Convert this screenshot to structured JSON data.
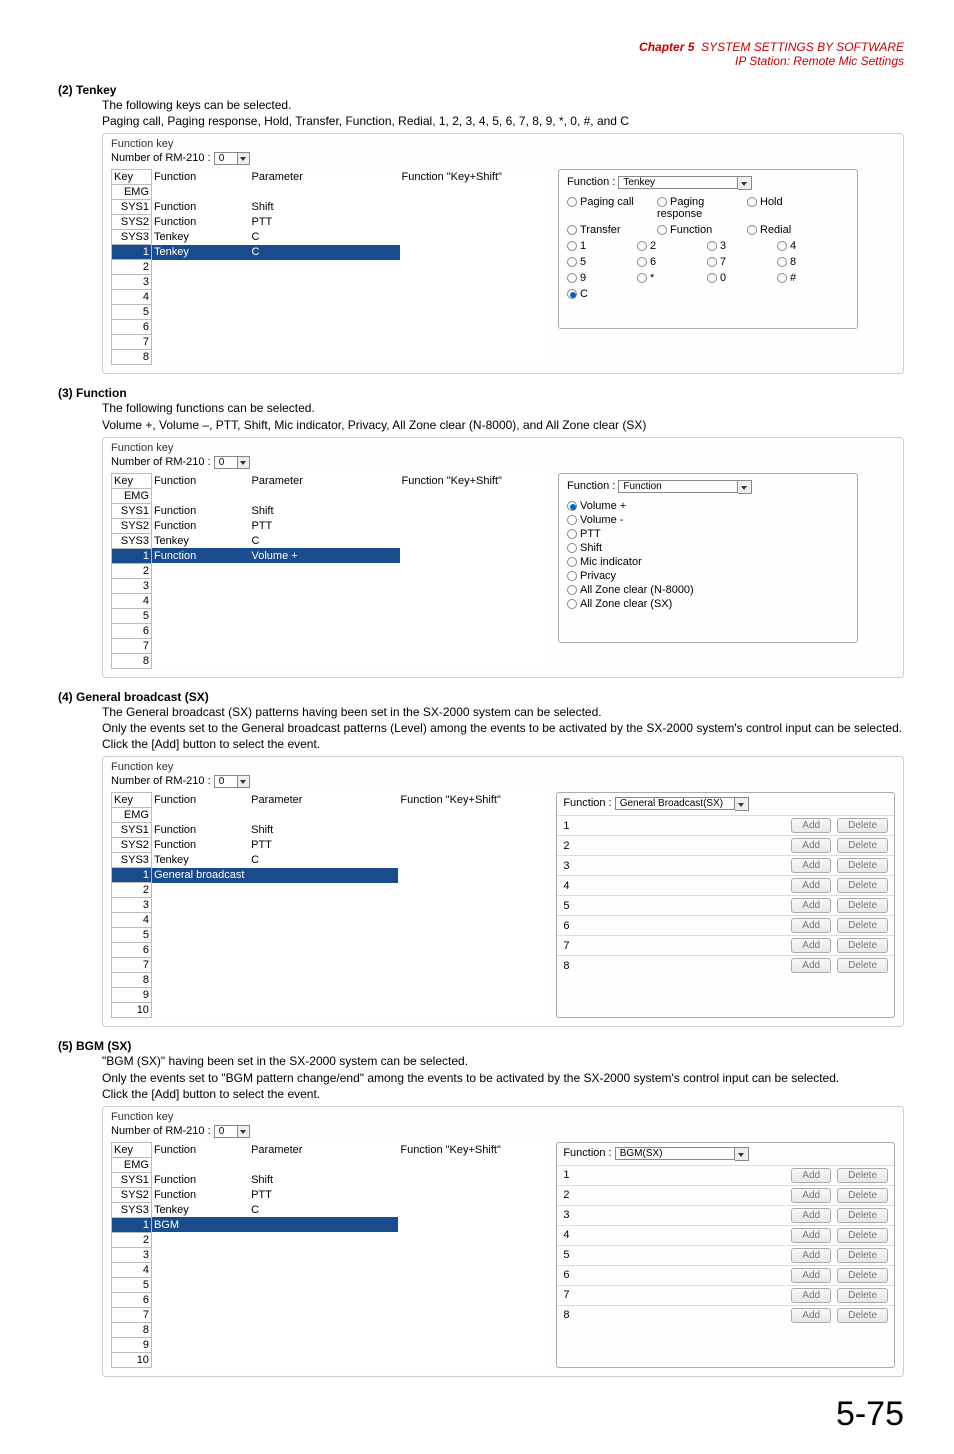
{
  "chapter": {
    "main": "Chapter 5",
    "title1": "SYSTEM SETTINGS BY SOFTWARE",
    "title2": "IP Station: Remote Mic Settings"
  },
  "sec2": {
    "label": "(2) Tenkey",
    "line1": "The following keys can be selected.",
    "line2": "Paging call, Paging response, Hold, Transfer, Function, Redial, 1, 2, 3, 4, 5, 6, 7, 8, 9, *, 0, #, and C",
    "panelTitle": "Function key",
    "rmLabel": "Number of RM-210 :",
    "rmVal": "0",
    "headers": {
      "key": "Key",
      "func": "Function",
      "param": "Parameter",
      "ks": "Function \"Key+Shift\""
    },
    "rows": [
      {
        "k": "EMG",
        "f": "",
        "p": ""
      },
      {
        "k": "SYS1",
        "f": "Function",
        "p": "Shift"
      },
      {
        "k": "SYS2",
        "f": "Function",
        "p": "PTT"
      },
      {
        "k": "SYS3",
        "f": "Tenkey",
        "p": "C"
      },
      {
        "k": "1",
        "f": "Tenkey",
        "p": "C",
        "hl": true
      },
      {
        "k": "2",
        "f": "",
        "p": ""
      },
      {
        "k": "3",
        "f": "",
        "p": ""
      },
      {
        "k": "4",
        "f": "",
        "p": ""
      },
      {
        "k": "5",
        "f": "",
        "p": ""
      },
      {
        "k": "6",
        "f": "",
        "p": ""
      },
      {
        "k": "7",
        "f": "",
        "p": ""
      },
      {
        "k": "8",
        "f": "",
        "p": ""
      }
    ],
    "right": {
      "label": "Function :",
      "value": "Tenkey",
      "radios": [
        {
          "l": "Paging call"
        },
        {
          "l": "Paging response"
        },
        {
          "l": "Hold"
        },
        {
          "l": "Transfer"
        },
        {
          "l": "Function"
        },
        {
          "l": "Redial"
        },
        {
          "l": "1",
          "half": true
        },
        {
          "l": "2",
          "half": true
        },
        {
          "l": "3",
          "half": true
        },
        {
          "l": "4",
          "half": true
        },
        {
          "l": "5",
          "half": true
        },
        {
          "l": "6",
          "half": true
        },
        {
          "l": "7",
          "half": true
        },
        {
          "l": "8",
          "half": true
        },
        {
          "l": "9",
          "half": true
        },
        {
          "l": "*",
          "half": true
        },
        {
          "l": "0",
          "half": true
        },
        {
          "l": "#",
          "half": true
        },
        {
          "l": "C",
          "half": true,
          "sel": true
        }
      ]
    }
  },
  "sec3": {
    "label": "(3) Function",
    "line1": "The following functions can be selected.",
    "line2": "Volume +, Volume –, PTT, Shift, Mic indicator, Privacy, All Zone clear (N-8000), and All Zone clear (SX)",
    "panelTitle": "Function key",
    "rmLabel": "Number of RM-210 :",
    "rmVal": "0",
    "headers": {
      "key": "Key",
      "func": "Function",
      "param": "Parameter",
      "ks": "Function \"Key+Shift\""
    },
    "rows": [
      {
        "k": "EMG",
        "f": "",
        "p": ""
      },
      {
        "k": "SYS1",
        "f": "Function",
        "p": "Shift"
      },
      {
        "k": "SYS2",
        "f": "Function",
        "p": "PTT"
      },
      {
        "k": "SYS3",
        "f": "Tenkey",
        "p": "C"
      },
      {
        "k": "1",
        "f": "Function",
        "p": "Volume +",
        "hl": true
      },
      {
        "k": "2",
        "f": "",
        "p": ""
      },
      {
        "k": "3",
        "f": "",
        "p": ""
      },
      {
        "k": "4",
        "f": "",
        "p": ""
      },
      {
        "k": "5",
        "f": "",
        "p": ""
      },
      {
        "k": "6",
        "f": "",
        "p": ""
      },
      {
        "k": "7",
        "f": "",
        "p": ""
      },
      {
        "k": "8",
        "f": "",
        "p": ""
      }
    ],
    "right": {
      "label": "Function :",
      "value": "Function",
      "radios": [
        {
          "l": "Volume +",
          "sel": true
        },
        {
          "l": "Volume -"
        },
        {
          "l": "PTT"
        },
        {
          "l": "Shift"
        },
        {
          "l": "Mic indicator"
        },
        {
          "l": "Privacy"
        },
        {
          "l": "All Zone clear (N-8000)"
        },
        {
          "l": "All Zone clear (SX)"
        }
      ]
    }
  },
  "sec4": {
    "label": "(4) General broadcast (SX)",
    "line1": "The General broadcast (SX) patterns having been set in the SX-2000 system can be selected.",
    "line2": "Only the events set to the General broadcast patterns (Level) among the events to be activated by the SX-2000 system's control input can be selected.",
    "line3": "Click the [Add] button to select the event.",
    "panelTitle": "Function key",
    "rmLabel": "Number of RM-210 :",
    "rmVal": "0",
    "headers": {
      "key": "Key",
      "func": "Function",
      "param": "Parameter",
      "ks": "Function \"Key+Shift\""
    },
    "rows": [
      {
        "k": "EMG",
        "f": "",
        "p": ""
      },
      {
        "k": "SYS1",
        "f": "Function",
        "p": "Shift"
      },
      {
        "k": "SYS2",
        "f": "Function",
        "p": "PTT"
      },
      {
        "k": "SYS3",
        "f": "Tenkey",
        "p": "C"
      },
      {
        "k": "1",
        "f": "General broadcast",
        "p": "",
        "hl": true
      },
      {
        "k": "2",
        "f": "",
        "p": ""
      },
      {
        "k": "3",
        "f": "",
        "p": ""
      },
      {
        "k": "4",
        "f": "",
        "p": ""
      },
      {
        "k": "5",
        "f": "",
        "p": ""
      },
      {
        "k": "6",
        "f": "",
        "p": ""
      },
      {
        "k": "7",
        "f": "",
        "p": ""
      },
      {
        "k": "8",
        "f": "",
        "p": ""
      },
      {
        "k": "9",
        "f": "",
        "p": ""
      },
      {
        "k": "10",
        "f": "",
        "p": ""
      }
    ],
    "right": {
      "label": "Function :",
      "value": "General Broadcast(SX)",
      "addLabel": "Add",
      "delLabel": "Delete",
      "count": 8
    }
  },
  "sec5": {
    "label": "(5) BGM (SX)",
    "line1": "\"BGM (SX)\" having been set in the SX-2000 system can be selected.",
    "line2": "Only the events set to \"BGM pattern change/end\" among the events to be activated by the SX-2000 system's control input can be selected.",
    "line3": "Click the [Add] button to select the event.",
    "panelTitle": "Function key",
    "rmLabel": "Number of RM-210 :",
    "rmVal": "0",
    "headers": {
      "key": "Key",
      "func": "Function",
      "param": "Parameter",
      "ks": "Function \"Key+Shift\""
    },
    "rows": [
      {
        "k": "EMG",
        "f": "",
        "p": ""
      },
      {
        "k": "SYS1",
        "f": "Function",
        "p": "Shift"
      },
      {
        "k": "SYS2",
        "f": "Function",
        "p": "PTT"
      },
      {
        "k": "SYS3",
        "f": "Tenkey",
        "p": "C"
      },
      {
        "k": "1",
        "f": "BGM",
        "p": "",
        "hl": true
      },
      {
        "k": "2",
        "f": "",
        "p": ""
      },
      {
        "k": "3",
        "f": "",
        "p": ""
      },
      {
        "k": "4",
        "f": "",
        "p": ""
      },
      {
        "k": "5",
        "f": "",
        "p": ""
      },
      {
        "k": "6",
        "f": "",
        "p": ""
      },
      {
        "k": "7",
        "f": "",
        "p": ""
      },
      {
        "k": "8",
        "f": "",
        "p": ""
      },
      {
        "k": "9",
        "f": "",
        "p": ""
      },
      {
        "k": "10",
        "f": "",
        "p": ""
      }
    ],
    "right": {
      "label": "Function :",
      "value": "BGM(SX)",
      "addLabel": "Add",
      "delLabel": "Delete",
      "count": 8
    }
  },
  "pageNum": "5-75"
}
